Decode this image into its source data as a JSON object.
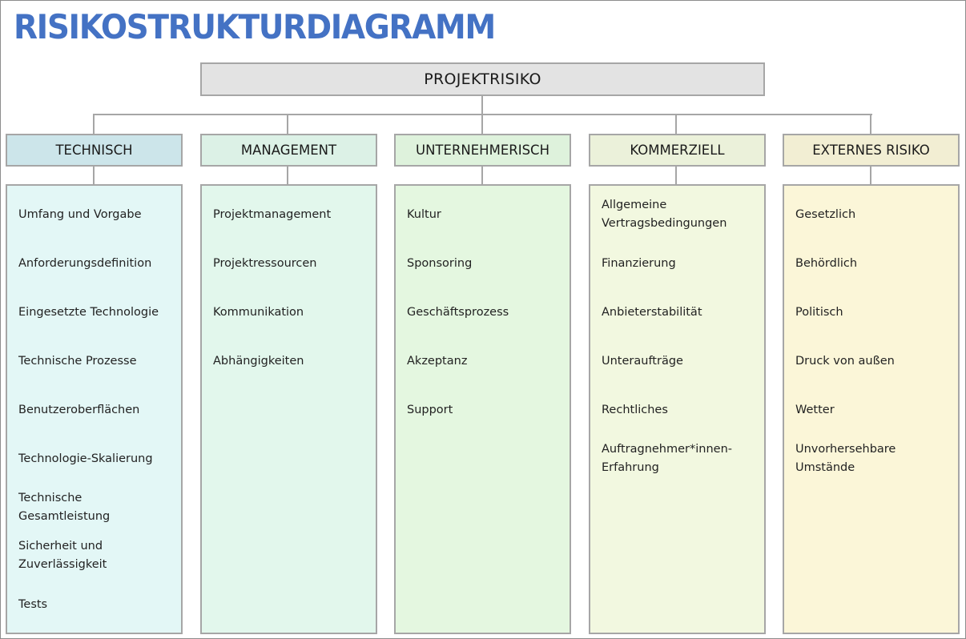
{
  "title": "RISIKOSTRUKTURDIAGRAMM",
  "root": {
    "label": "PROJEKTRISIKO",
    "color": "#e3e3e3"
  },
  "categories": [
    {
      "label": "TECHNISCH",
      "header_color": "#cce5ea",
      "list_color": "#e3f7f6",
      "items": [
        "Umfang und Vorgabe",
        "Anforderungsdefinition",
        "Eingesetzte Technologie",
        "Technische Prozesse",
        "Benutzeroberflächen",
        "Technologie-Skalierung",
        "Technische Gesamtleistung",
        "Sicherheit und Zuverlässigkeit",
        "Tests"
      ]
    },
    {
      "label": "MANAGEMENT",
      "header_color": "#dcf1e6",
      "list_color": "#e2f7ec",
      "items": [
        "Projektmanagement",
        "Projektressourcen",
        "Kommunikation",
        "Abhängigkeiten"
      ]
    },
    {
      "label": "UNTERNEHMERISCH",
      "header_color": "#def2dc",
      "list_color": "#e4f7e0",
      "items": [
        "Kultur",
        "Sponsoring",
        "Geschäftsprozess",
        "Akzeptanz",
        "Support"
      ]
    },
    {
      "label": "KOMMERZIELL",
      "header_color": "#ebf1da",
      "list_color": "#f2f8e0",
      "items": [
        "Allgemeine Vertragsbedingungen",
        "Finanzierung",
        "Anbieterstabilität",
        "Unteraufträge",
        "Rechtliches",
        "Auftragnehmer*innen-Erfahrung"
      ]
    },
    {
      "label": "EXTERNES RISIKO",
      "header_color": "#f2eed3",
      "list_color": "#fbf6d8",
      "items": [
        "Gesetzlich",
        "Behördlich",
        "Politisch",
        "Druck von außen",
        "Wetter",
        "Unvorhersehbare Umstände"
      ]
    }
  ],
  "colors": {
    "title": "#4472c4",
    "connector": "#a6a6a6",
    "border": "#a6a6a6"
  }
}
